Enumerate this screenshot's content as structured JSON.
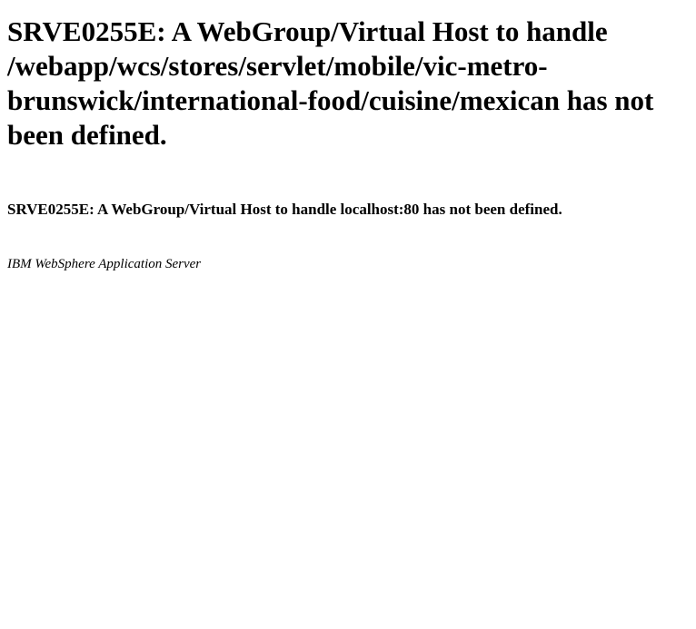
{
  "error": {
    "heading": "SRVE0255E: A WebGroup/Virtual Host to handle /webapp/wcs/stores/servlet/mobile/vic-metro-brunswick/international-food/cuisine/mexican has not been defined.",
    "detail": "SRVE0255E: A WebGroup/Virtual Host to handle localhost:80 has not been defined.",
    "server_signature": "IBM WebSphere Application Server"
  }
}
